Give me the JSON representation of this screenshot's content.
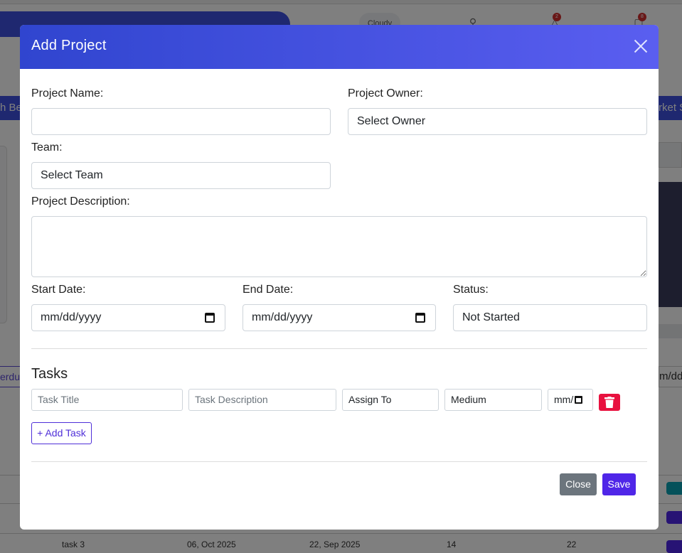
{
  "background": {
    "weather_label": "Cloudy",
    "notifications_count": "2",
    "cart_count": "8",
    "nav_left_text": "h Be",
    "nav_right_text": "rket S",
    "overdue_text": "verdu",
    "date_right_text": "m/dd/",
    "table_row": {
      "task": "task 3",
      "start": "06, Oct 2025",
      "end": "22, Sep 2025",
      "col4": "14",
      "col5": "22"
    }
  },
  "modal": {
    "title": "Add Project",
    "fields": {
      "project_name_label": "Project Name:",
      "project_name_value": "",
      "project_owner_label": "Project Owner:",
      "project_owner_value": "Select Owner",
      "team_label": "Team:",
      "team_value": "Select Team",
      "description_label": "Project Description:",
      "description_value": "",
      "start_date_label": "Start Date:",
      "start_date_value": "mm/dd/yyyy",
      "end_date_label": "End Date:",
      "end_date_value": "mm/dd/yyyy",
      "status_label": "Status:",
      "status_value": "Not Started"
    },
    "tasks": {
      "heading": "Tasks",
      "title_placeholder": "Task Title",
      "description_placeholder": "Task Description",
      "assign_value": "Assign To",
      "priority_value": "Medium",
      "date_value": "mm/",
      "add_task_label": "+ Add Task"
    },
    "footer": {
      "close_label": "Close",
      "save_label": "Save"
    }
  },
  "colors": {
    "header_start": "#3045cf",
    "header_end": "#5a5ef0",
    "primary": "#4f26e8",
    "danger": "#e8113f",
    "secondary": "#6c757d"
  }
}
